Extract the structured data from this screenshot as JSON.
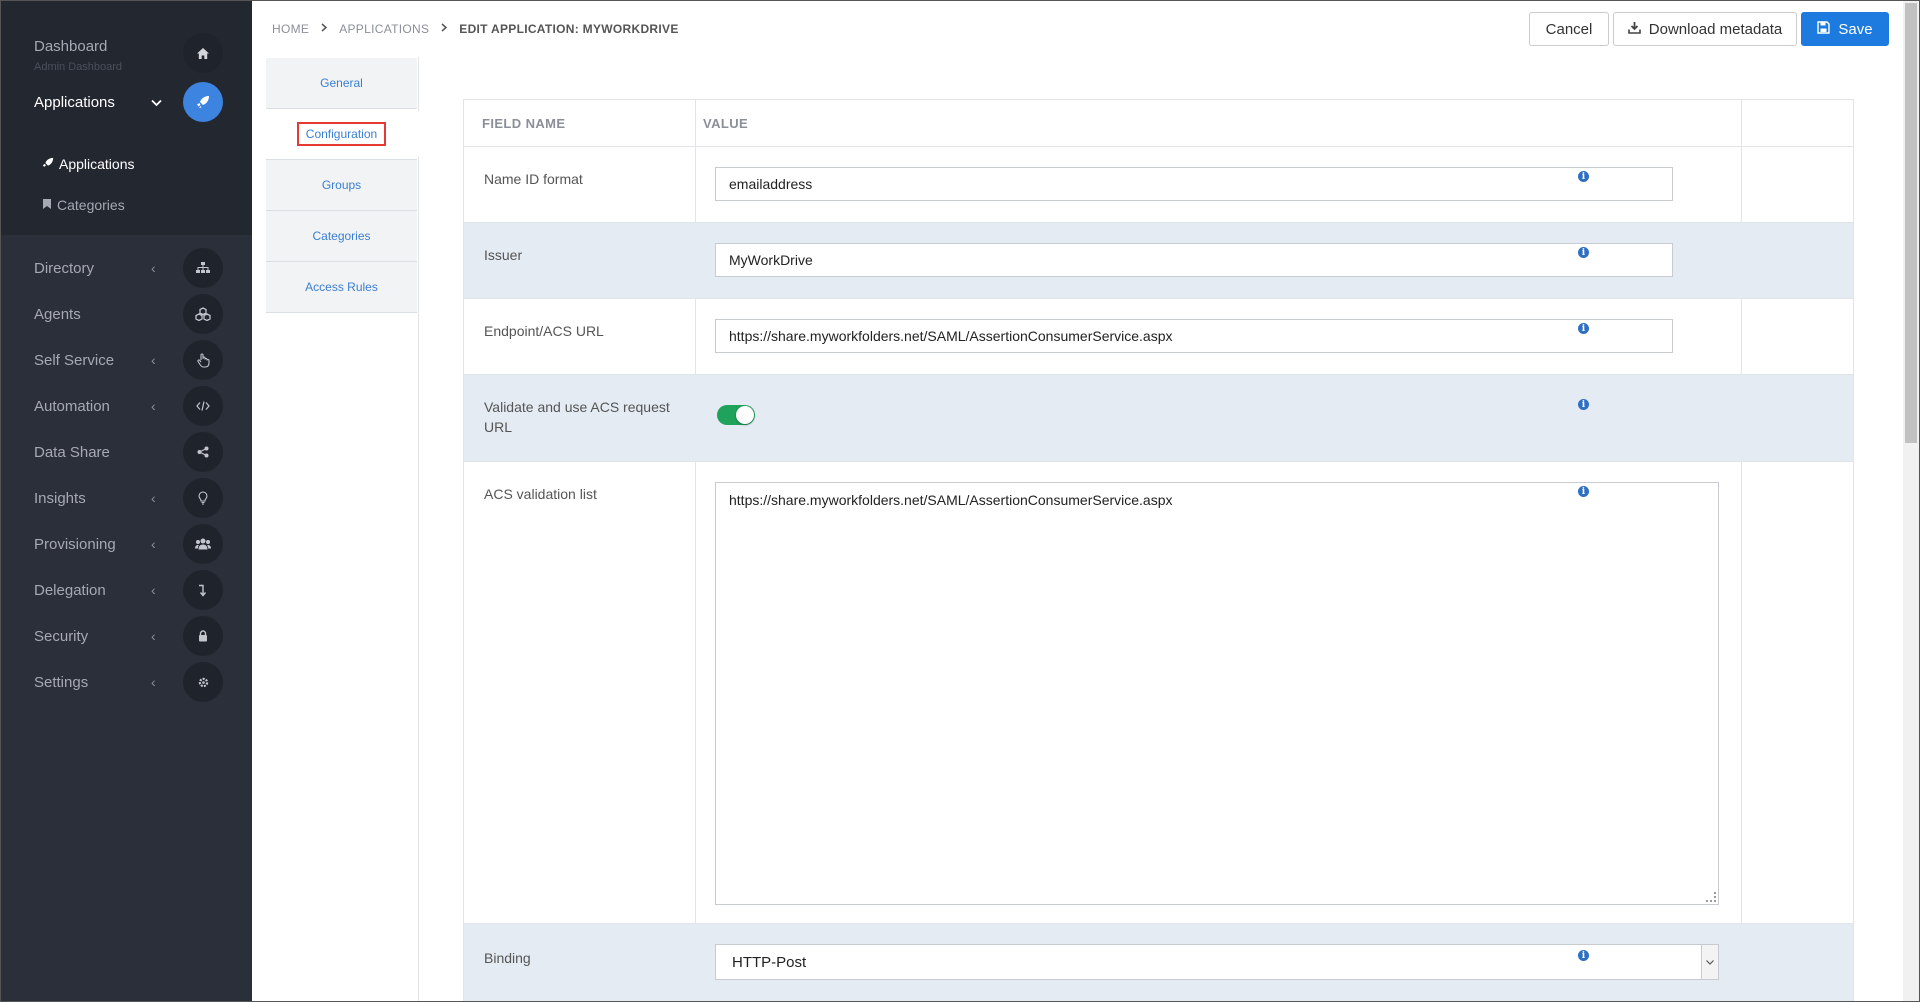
{
  "sidebar": {
    "dashboard": {
      "label": "Dashboard",
      "sublabel": "Admin Dashboard",
      "icon": "home-icon"
    },
    "applications": {
      "label": "Applications",
      "icon": "rocket-icon"
    },
    "subnav": [
      {
        "label": "Applications",
        "icon": "rocket-icon"
      },
      {
        "label": "Categories",
        "icon": "bookmark-icon"
      }
    ],
    "items": [
      {
        "label": "Directory",
        "icon": "sitemap-icon",
        "chevron": "‹"
      },
      {
        "label": "Agents",
        "icon": "cubes-icon",
        "chevron": ""
      },
      {
        "label": "Self Service",
        "icon": "hand-pointer-icon",
        "chevron": "‹"
      },
      {
        "label": "Automation",
        "icon": "code-icon",
        "chevron": "‹"
      },
      {
        "label": "Data Share",
        "icon": "share-icon",
        "chevron": ""
      },
      {
        "label": "Insights",
        "icon": "lightbulb-icon",
        "chevron": "‹"
      },
      {
        "label": "Provisioning",
        "icon": "users-icon",
        "chevron": "‹"
      },
      {
        "label": "Delegation",
        "icon": "level-down-icon",
        "chevron": "‹"
      },
      {
        "label": "Security",
        "icon": "lock-icon",
        "chevron": "‹"
      },
      {
        "label": "Settings",
        "icon": "gear-icon",
        "chevron": "‹"
      }
    ]
  },
  "breadcrumb": {
    "home": "HOME",
    "applications": "APPLICATIONS",
    "current": "EDIT APPLICATION: MYWORKDRIVE"
  },
  "toolbar": {
    "cancel": "Cancel",
    "download": "Download metadata",
    "save": "Save"
  },
  "tabs": [
    {
      "label": "General"
    },
    {
      "label": "Configuration",
      "active": true
    },
    {
      "label": "Groups"
    },
    {
      "label": "Categories"
    },
    {
      "label": "Access Rules"
    }
  ],
  "table": {
    "headers": {
      "field": "FIELD NAME",
      "value": "VALUE"
    },
    "rows": [
      {
        "field": "Name ID format",
        "value": "emailaddress"
      },
      {
        "field": "Issuer",
        "value": "MyWorkDrive"
      },
      {
        "field": "Endpoint/ACS URL",
        "value": "https://share.myworkfolders.net/SAML/AssertionConsumerService.aspx"
      },
      {
        "field": "Validate and use ACS request URL",
        "toggle": true
      },
      {
        "field": "ACS validation list",
        "value": "https://share.myworkfolders.net/SAML/AssertionConsumerService.aspx"
      },
      {
        "field": "Binding",
        "value": "HTTP-Post"
      }
    ]
  },
  "colors": {
    "sidebar_bg": "#2b2f3a",
    "accent": "#1d7be0",
    "toggle_on": "#1fa25a",
    "highlight": "#e53935",
    "row_alt": "#e5ebf3"
  }
}
